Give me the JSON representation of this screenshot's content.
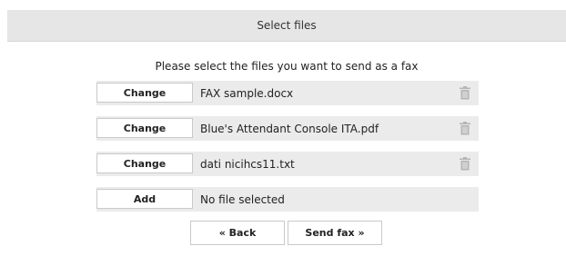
{
  "header": {
    "title": "Select files"
  },
  "instructions": "Please select the files you want to send as a fax",
  "files": [
    {
      "button_label": "Change",
      "filename": "FAX sample.docx",
      "delete_icon": "trash-icon"
    },
    {
      "button_label": "Change",
      "filename": "Blue's Attendant Console ITA.pdf",
      "delete_icon": "trash-icon"
    },
    {
      "button_label": "Change",
      "filename": "dati nicihcs11.txt",
      "delete_icon": "trash-icon"
    }
  ],
  "add_row": {
    "button_label": "Add",
    "status": "No file selected"
  },
  "navigation": {
    "back_label": "« Back",
    "send_label": "Send fax »"
  },
  "colors": {
    "header_bg": "#e6e6e6",
    "row_bg": "#ebebeb",
    "icon": "#b5b5b5"
  }
}
